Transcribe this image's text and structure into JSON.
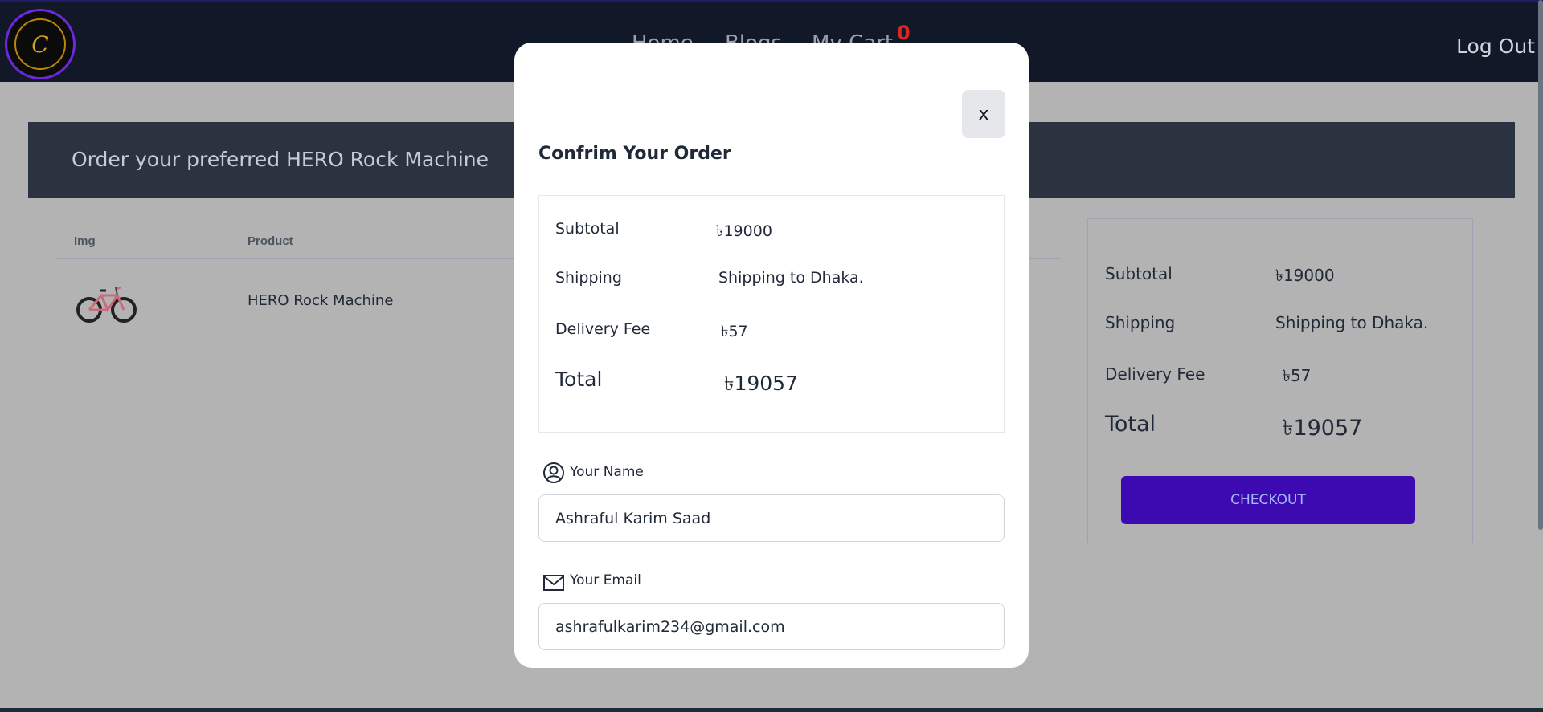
{
  "nav": {
    "logo_text": "C",
    "home": "Home",
    "blogs": "Blogs",
    "cart": "My Cart",
    "cart_count": "0",
    "logout": "Log Out"
  },
  "banner": {
    "title": "Order your preferred HERO Rock Machine"
  },
  "table": {
    "headers": [
      "Img",
      "Product"
    ],
    "rows": [
      {
        "product": "HERO Rock Machine"
      }
    ]
  },
  "summary": {
    "subtotal_label": "Subtotal",
    "subtotal_value": "৳19000",
    "shipping_label": "Shipping",
    "shipping_value": "Shipping to Dhaka.",
    "delivery_label": "Delivery Fee",
    "delivery_value": "৳57",
    "total_label": "Total",
    "total_value": "৳19057",
    "checkout_label": "CHECKOUT"
  },
  "modal": {
    "close_label": "x",
    "title": "Confrim Your Order",
    "subtotal_label": "Subtotal",
    "subtotal_value": "৳19000",
    "shipping_label": "Shipping",
    "shipping_value": "Shipping to Dhaka.",
    "delivery_label": "Delivery Fee",
    "delivery_value": "৳57",
    "total_label": "Total",
    "total_value": "৳19057",
    "name_label": "Your Name",
    "name_value": "Ashraful Karim Saad",
    "email_label": "Your Email",
    "email_value": "ashrafulkarim234@gmail.com"
  },
  "colors": {
    "navbar": "#111827",
    "overlay_bg": "#b3b3b3",
    "banner": "#2b3340",
    "checkout_button": "#3c0ab0",
    "cart_badge": "#dc2626"
  },
  "icons": [
    "user-circle-icon",
    "envelope-icon"
  ]
}
